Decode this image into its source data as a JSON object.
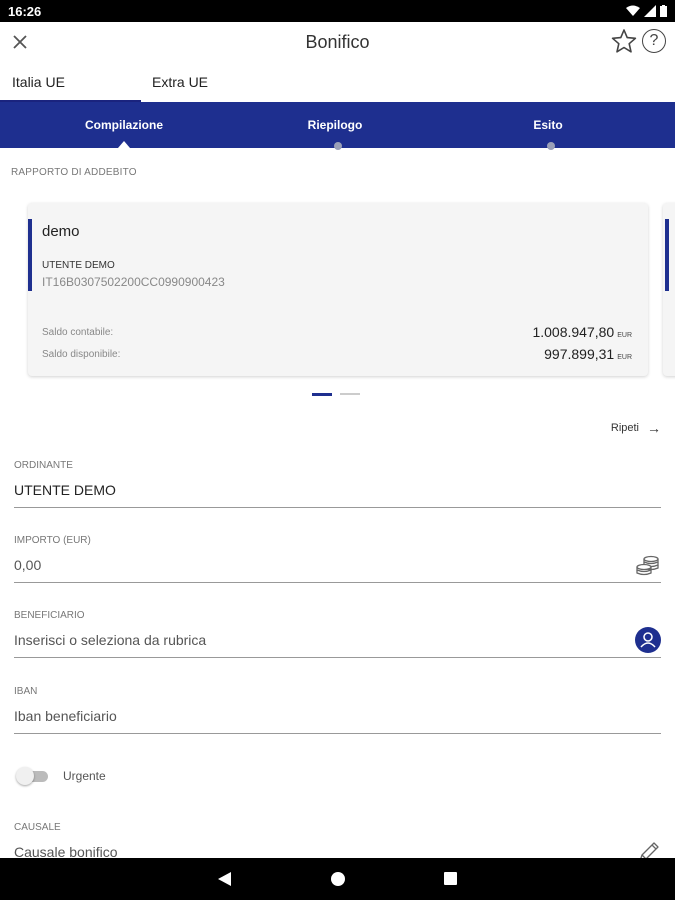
{
  "status": {
    "time": "16:26"
  },
  "header": {
    "title": "Bonifico"
  },
  "tabs": [
    {
      "label": "Italia UE"
    },
    {
      "label": "Extra UE"
    }
  ],
  "steps": [
    {
      "label": "Compilazione"
    },
    {
      "label": "Riepilogo"
    },
    {
      "label": "Esito"
    }
  ],
  "account_section": {
    "label": "RAPPORTO DI ADDEBITO",
    "card": {
      "name": "demo",
      "owner": "UTENTE DEMO",
      "iban": "IT16B0307502200CC0990900423",
      "balance_label": "Saldo contabile:",
      "balance_value": "1.008.947,80",
      "available_label": "Saldo disponibile:",
      "available_value": "997.899,31",
      "currency": "EUR"
    }
  },
  "repeat": {
    "label": "Ripeti",
    "arrow": "→"
  },
  "form": {
    "ordinante": {
      "label": "ORDINANTE",
      "value": "UTENTE DEMO"
    },
    "importo": {
      "label": "IMPORTO (EUR)",
      "value": "0,00"
    },
    "beneficiario": {
      "label": "BENEFICIARIO",
      "placeholder": "Inserisci o seleziona da rubrica"
    },
    "iban": {
      "label": "IBAN",
      "placeholder": "Iban beneficiario"
    },
    "urgente": {
      "label": "Urgente",
      "checked": false
    },
    "causale": {
      "label": "CAUSALE",
      "placeholder": "Causale bonifico"
    }
  },
  "icons": {
    "close": "close-icon",
    "star": "star-icon",
    "help": "help-icon",
    "coins": "coins-icon",
    "contact": "contact-icon",
    "pencil": "pencil-icon"
  },
  "colors": {
    "primary": "#1e2f8f",
    "status_bar": "#000000"
  }
}
